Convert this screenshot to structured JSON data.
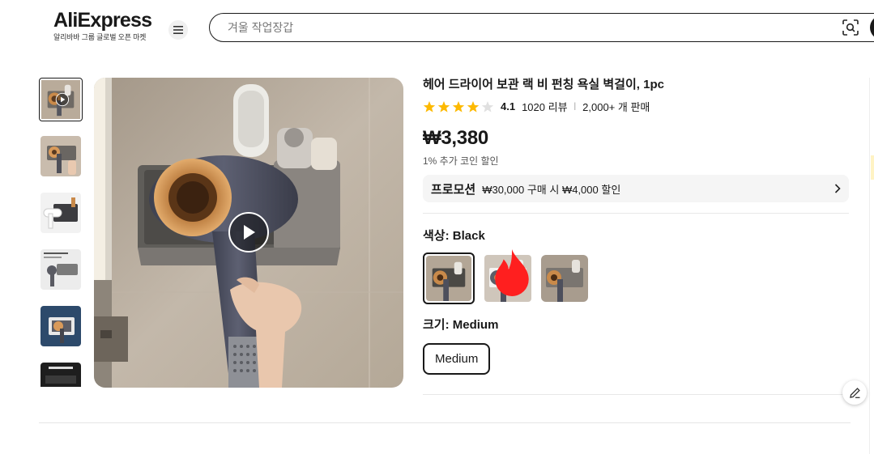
{
  "header": {
    "logo": "AliExpress",
    "logo_sub": "알리바바 그룹 글로벌 오픈 마켓",
    "search_placeholder": "겨울 작업장갑"
  },
  "icons": [
    "menu-icon",
    "camera-search-icon",
    "play-icon",
    "star-icon",
    "chevron-right-icon",
    "fire-icon",
    "edit-icon"
  ],
  "product": {
    "title": "헤어 드라이어 보관 랙 비 펀칭 욕실 벽걸이, 1pc",
    "rating": "4.1",
    "rating_fraction": 0.82,
    "reviews": "1020 리뷰",
    "sold": "2,000+ 개 판매",
    "price": "₩3,380",
    "coin_discount": "1% 추가 코인 할인",
    "promo_label": "프로모션",
    "promo_text": "₩30,000 구매 시 ₩4,000 할인",
    "color_label": "색상: Black",
    "size_label": "크기: Medium",
    "size_option": "Medium"
  },
  "colors": {
    "accent": "#191919",
    "star": "#FDB900",
    "star_empty": "#e0e0e0",
    "hot": "#ff1f1f"
  }
}
